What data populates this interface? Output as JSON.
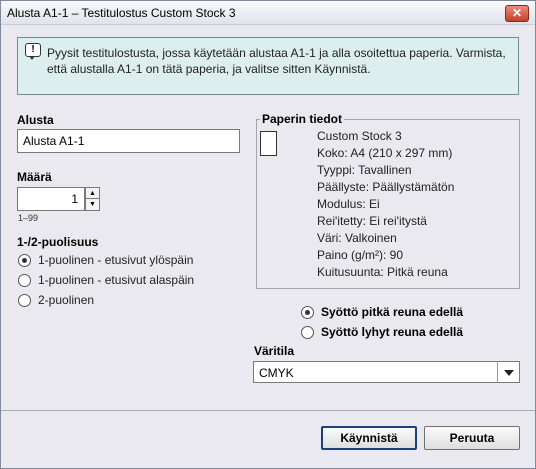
{
  "window": {
    "title": "Alusta A1-1 – Testitulostus Custom Stock 3",
    "close_label": "✕"
  },
  "info": {
    "message": "Pyysit testitulostusta, jossa käytetään alustaa A1-1 ja alla osoitettua paperia. Varmista, että alustalla A1-1 on tätä paperia, ja valitse sitten Käynnistä.",
    "icon": "message-icon"
  },
  "tray": {
    "label": "Alusta",
    "value": "Alusta A1-1"
  },
  "quantity": {
    "label": "Määrä",
    "value": "1",
    "range": "1–99"
  },
  "sides": {
    "label": "1-/2-puolisuus",
    "options": [
      {
        "label": "1-puolinen - etusivut ylöspäin",
        "selected": true
      },
      {
        "label": "1-puolinen - etusivut alaspäin",
        "selected": false
      },
      {
        "label": "2-puolinen",
        "selected": false
      }
    ]
  },
  "paper_info": {
    "title": "Paperin tiedot",
    "lines": [
      "Custom Stock 3",
      "Koko: A4 (210 x 297 mm)",
      "Tyyppi: Tavallinen",
      "Päällyste: Päällystämätön",
      "Modulus: Ei",
      "Rei'itetty: Ei rei'itystä",
      "Väri: Valkoinen",
      "Paino (g/m²): 90",
      "Kuitusuunta: Pitkä reuna"
    ]
  },
  "feed": {
    "options": [
      {
        "label": "Syöttö pitkä reuna edellä",
        "selected": true
      },
      {
        "label": "Syöttö lyhyt reuna edellä",
        "selected": false
      }
    ]
  },
  "color_mode": {
    "label": "Väritila",
    "value": "CMYK"
  },
  "buttons": {
    "start": "Käynnistä",
    "cancel": "Peruuta"
  }
}
